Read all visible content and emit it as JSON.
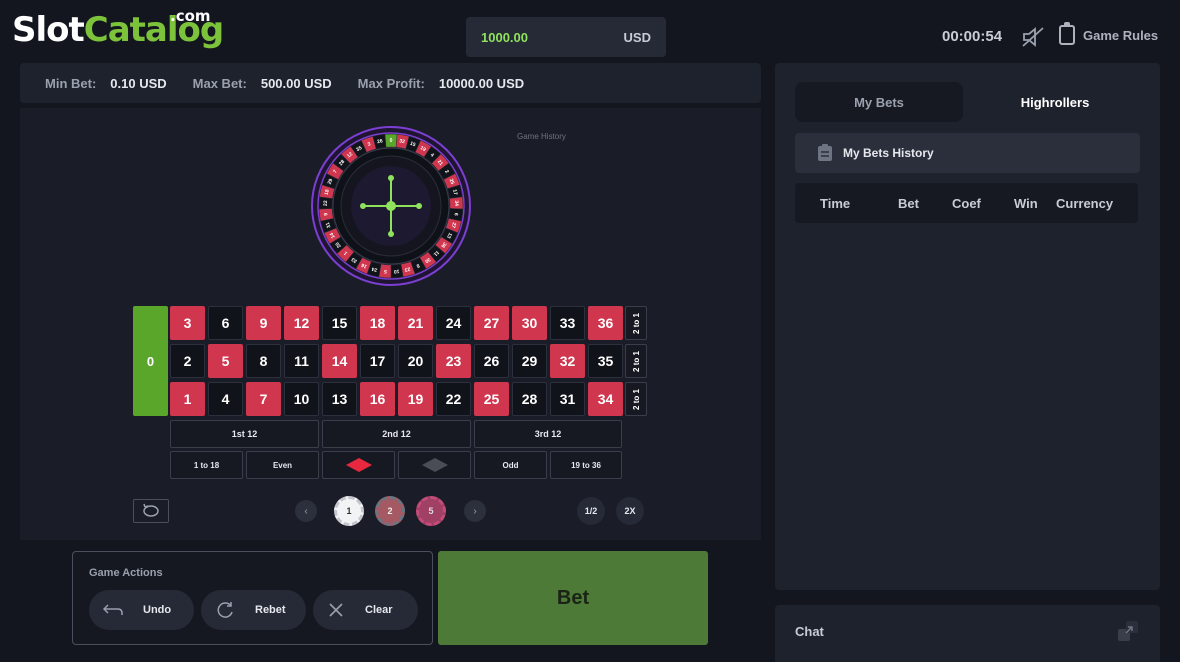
{
  "logo": {
    "part1": "Slot",
    "part2": "Catalog",
    "suffix": ".com"
  },
  "header": {
    "balance": "1000.00",
    "currency": "USD",
    "timer": "00:00:54",
    "rules_label": "Game Rules"
  },
  "limits": {
    "min_label": "Min Bet:",
    "min_value": "0.10 USD",
    "max_label": "Max Bet:",
    "max_value": "500.00 USD",
    "profit_label": "Max Profit:",
    "profit_value": "10000.00 USD"
  },
  "game": {
    "history_label": "Game History",
    "zero": "0",
    "rows": [
      [
        {
          "n": "3",
          "c": "red"
        },
        {
          "n": "6",
          "c": "black"
        },
        {
          "n": "9",
          "c": "red"
        },
        {
          "n": "12",
          "c": "red"
        },
        {
          "n": "15",
          "c": "black"
        },
        {
          "n": "18",
          "c": "red"
        },
        {
          "n": "21",
          "c": "red"
        },
        {
          "n": "24",
          "c": "black"
        },
        {
          "n": "27",
          "c": "red"
        },
        {
          "n": "30",
          "c": "red"
        },
        {
          "n": "33",
          "c": "black"
        },
        {
          "n": "36",
          "c": "red"
        }
      ],
      [
        {
          "n": "2",
          "c": "black"
        },
        {
          "n": "5",
          "c": "red"
        },
        {
          "n": "8",
          "c": "black"
        },
        {
          "n": "11",
          "c": "black"
        },
        {
          "n": "14",
          "c": "red"
        },
        {
          "n": "17",
          "c": "black"
        },
        {
          "n": "20",
          "c": "black"
        },
        {
          "n": "23",
          "c": "red"
        },
        {
          "n": "26",
          "c": "black"
        },
        {
          "n": "29",
          "c": "black"
        },
        {
          "n": "32",
          "c": "red"
        },
        {
          "n": "35",
          "c": "black"
        }
      ],
      [
        {
          "n": "1",
          "c": "red"
        },
        {
          "n": "4",
          "c": "black"
        },
        {
          "n": "7",
          "c": "red"
        },
        {
          "n": "10",
          "c": "black"
        },
        {
          "n": "13",
          "c": "black"
        },
        {
          "n": "16",
          "c": "red"
        },
        {
          "n": "19",
          "c": "red"
        },
        {
          "n": "22",
          "c": "black"
        },
        {
          "n": "25",
          "c": "red"
        },
        {
          "n": "28",
          "c": "black"
        },
        {
          "n": "31",
          "c": "black"
        },
        {
          "n": "34",
          "c": "red"
        }
      ]
    ],
    "column_label": "2 to 1",
    "dozens": [
      "1st 12",
      "2nd 12",
      "3rd 12"
    ],
    "outside": [
      "1 to 18",
      "Even",
      "",
      "",
      "Odd",
      "19 to 36"
    ],
    "chips": [
      "1",
      "2",
      "5"
    ],
    "half_label": "1/2",
    "double_label": "2X",
    "wheel_numbers": [
      "0",
      "32",
      "15",
      "19",
      "4",
      "21",
      "2",
      "25",
      "17",
      "34",
      "6",
      "27",
      "13",
      "36",
      "11",
      "30",
      "8",
      "23",
      "10",
      "5",
      "24",
      "16",
      "33",
      "1",
      "20",
      "14",
      "31",
      "9",
      "22",
      "18",
      "29",
      "7",
      "28",
      "12",
      "35",
      "3",
      "26"
    ],
    "colors": {
      "red": "#d0374f",
      "black": "#11131a",
      "green": "#5aa62a",
      "accent": "#8fe25b",
      "wheel_ring": "#7b3fd1"
    }
  },
  "actions": {
    "title": "Game Actions",
    "undo": "Undo",
    "rebet": "Rebet",
    "clear": "Clear",
    "bet": "Bet"
  },
  "sidebar": {
    "tab_my_bets": "My Bets",
    "tab_highrollers": "Highrollers",
    "history_title": "My Bets History",
    "columns": [
      "Time",
      "Bet",
      "Coef",
      "Win",
      "Currency"
    ]
  },
  "chat": {
    "label": "Chat"
  }
}
